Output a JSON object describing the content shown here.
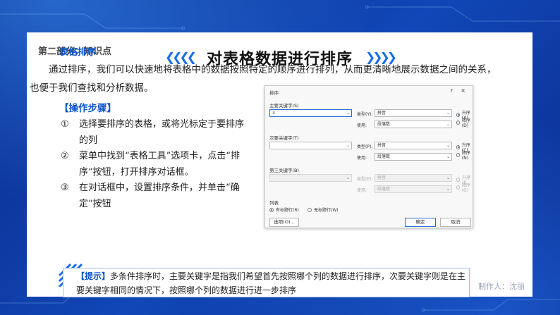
{
  "slide": {
    "section_label": "第二部分：知识点",
    "title": "对表格数据进行排序",
    "chevrons_left": "❮❮❮❮",
    "chevrons_right": "❯❯❯❯",
    "subhead": "表格排序",
    "paragraph": "通过排序，我们可以快速地将表格中的数据按照特定的顺序进行排列，从而更清晰地展示数据之间的关系，也便于我们查找和分析数据。",
    "steps_title": "【操作步骤】",
    "steps": [
      {
        "num": "①",
        "text": "选择要排序的表格，或将光标定于要排序的列"
      },
      {
        "num": "②",
        "text": "菜单中找到“表格工具”选项卡，点击“排序”按钮，打开排序对话框。"
      },
      {
        "num": "③",
        "text": "在对话框中，设置排序条件，并单击“确定”按钮"
      }
    ],
    "tip_badge": "【提示】",
    "tip_text": "多条件排序时，主要关键字是指我们希望首先按照哪个列的数据进行排序，次要关键字则是在主要关键字相同的情况下，按照哪个列的数据进行进一步排序",
    "author": "制作人：沈丽",
    "accent_color": "#0d55c9"
  },
  "dialog": {
    "title": "排序",
    "help": "?",
    "close": "×",
    "type_label_1": "类型(Y):",
    "use_label_1": "使用:",
    "type_label_2": "类型(P):",
    "use_label_2": "使用:",
    "type_label_3": "类型(E):",
    "use_label_3": "使用:",
    "primary": {
      "label": "主要关键字(S)",
      "value": "3",
      "type": "拼音",
      "use": "段落数",
      "asc": "升序(A)",
      "desc": "降序(D)"
    },
    "secondary": {
      "label": "次要关键字(T)",
      "value": "",
      "type": "拼音",
      "use": "段落数",
      "asc": "升序(C)",
      "desc": "降序(N)"
    },
    "tertiary": {
      "label": "第三关键字(B)",
      "value": "",
      "type": "拼音",
      "use": "段落数",
      "asc": "升序(I)",
      "desc": "降序(G)"
    },
    "list_label": "列表",
    "has_header": "有标题行(R)",
    "no_header": "无标题行(W)",
    "options_btn": "选项(O)...",
    "ok_btn": "确定",
    "cancel_btn": "取消"
  }
}
